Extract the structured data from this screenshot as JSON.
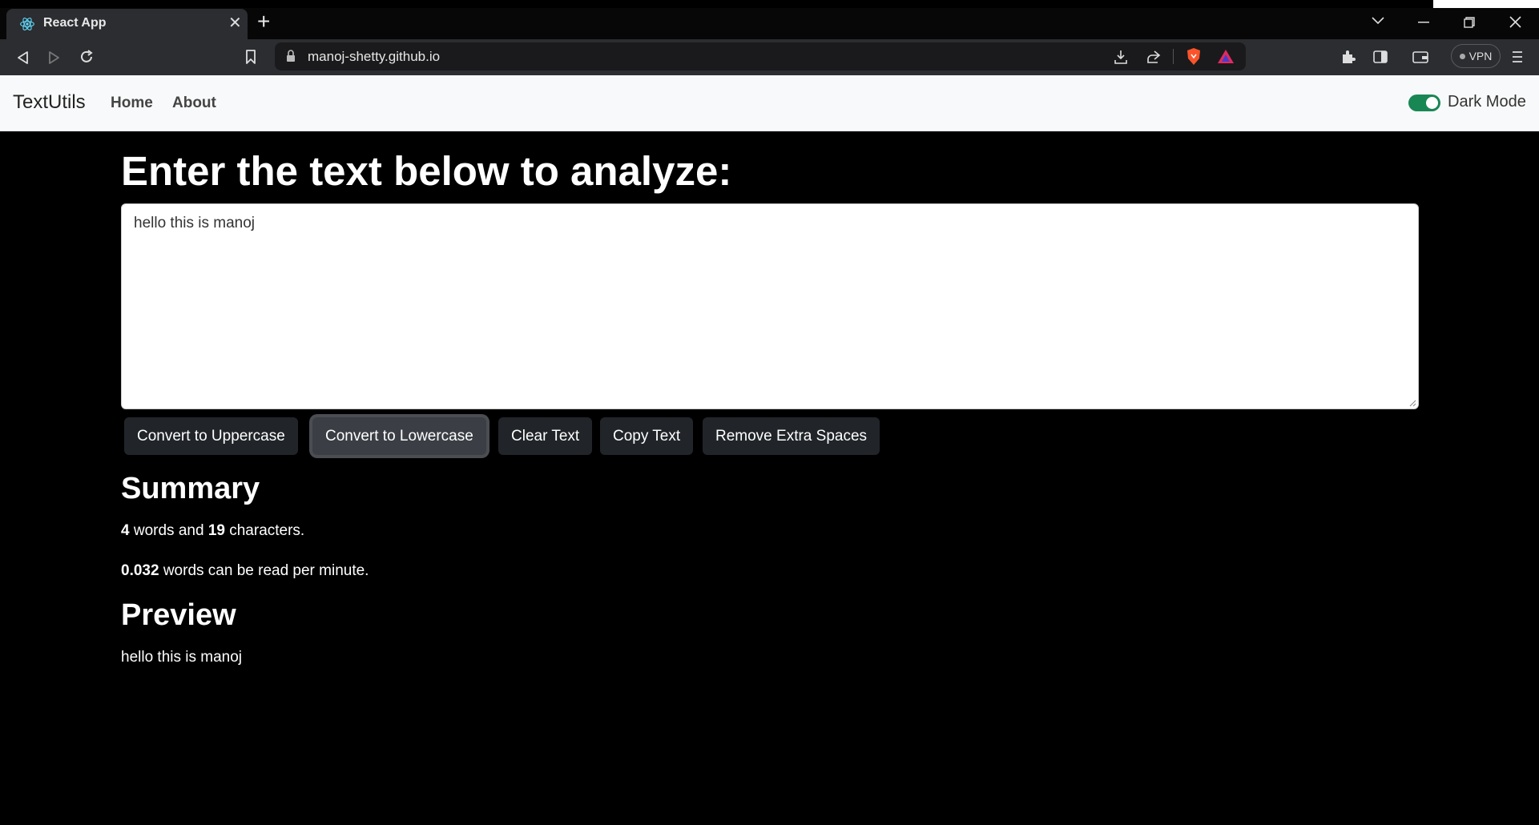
{
  "browser": {
    "tab_title": "React App",
    "url": "manoj-shetty.github.io",
    "vpn_label": "VPN"
  },
  "navbar": {
    "brand": "TextUtils",
    "links": [
      {
        "label": "Home"
      },
      {
        "label": "About"
      }
    ],
    "dark_mode_label": "Dark Mode",
    "dark_mode_enabled": true
  },
  "main": {
    "heading": "Enter the text below to analyze:",
    "textarea_value": "hello this is manoj",
    "buttons": [
      {
        "label": "Convert to Uppercase"
      },
      {
        "label": "Convert to Lowercase"
      },
      {
        "label": "Clear Text"
      },
      {
        "label": "Copy Text"
      },
      {
        "label": "Remove Extra Spaces"
      }
    ]
  },
  "summary": {
    "title": "Summary",
    "word_count": "4",
    "words_and": " words and ",
    "char_count": "19",
    "characters_suffix": " characters.",
    "read_time": "0.032",
    "read_suffix": " words can be read per minute."
  },
  "preview": {
    "title": "Preview",
    "text": "hello this is manoj"
  },
  "colors": {
    "page_bg": "#000000",
    "navbar_bg": "#f8f9fa",
    "button_bg": "#212529",
    "switch_on": "#198754"
  }
}
